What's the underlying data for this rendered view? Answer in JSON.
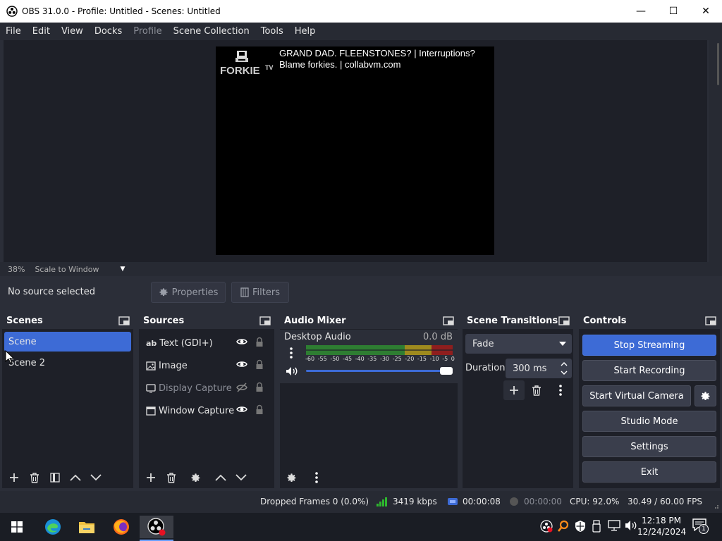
{
  "window": {
    "title": "OBS 31.0.0 - Profile: Untitled - Scenes: Untitled",
    "minimize": "—",
    "maximize": "☐",
    "close": "✕"
  },
  "menu": [
    "File",
    "Edit",
    "View",
    "Docks",
    "Profile",
    "Scene Collection",
    "Tools",
    "Help"
  ],
  "menu_disabled": [
    "Profile"
  ],
  "preview": {
    "logo_text": "FORKIE",
    "logo_sub": "TV",
    "overlay_line1": "GRAND DAD. FLEENSTONES? | Interruptions?",
    "overlay_line2": "Blame forkies. | collabvm.com"
  },
  "zoom": {
    "percent": "38%",
    "mode": "Scale to Window"
  },
  "context": {
    "no_source": "No source selected",
    "properties_label": "Properties",
    "filters_label": "Filters"
  },
  "scenes": {
    "title": "Scenes",
    "items": [
      {
        "label": "Scene",
        "selected": true
      },
      {
        "label": "Scene 2",
        "selected": false
      }
    ]
  },
  "sources": {
    "title": "Sources",
    "items": [
      {
        "label": "Text (GDI+)",
        "icon": "text-icon",
        "visible": true
      },
      {
        "label": "Image",
        "icon": "image-icon",
        "visible": true
      },
      {
        "label": "Display Capture",
        "icon": "monitor-icon",
        "visible": false
      },
      {
        "label": "Window Capture",
        "icon": "window-icon",
        "visible": true
      }
    ]
  },
  "mixer": {
    "title": "Audio Mixer",
    "track": {
      "name": "Desktop Audio",
      "db": "0.0 dB",
      "scale": [
        "-60",
        "-55",
        "-50",
        "-45",
        "-40",
        "-35",
        "-30",
        "-25",
        "-20",
        "-15",
        "-10",
        "-5",
        "0"
      ],
      "volume_fraction": 1.0
    }
  },
  "transitions": {
    "title": "Scene Transitions",
    "selected": "Fade",
    "duration_label": "Duration",
    "duration_value": "300 ms"
  },
  "controls": {
    "title": "Controls",
    "stop_streaming": "Stop Streaming",
    "start_recording": "Start Recording",
    "start_virtual_camera": "Start Virtual Camera",
    "studio_mode": "Studio Mode",
    "settings": "Settings",
    "exit": "Exit"
  },
  "status": {
    "dropped": "Dropped Frames 0 (0.0%)",
    "bitrate": "3419 kbps",
    "stream_time": "00:00:08",
    "rec_time": "00:00:00",
    "cpu": "CPU: 92.0%",
    "fps": "30.49 / 60.00 FPS"
  },
  "taskbar": {
    "time": "12:18 PM",
    "date": "12/24/2024",
    "notification_count": "1"
  },
  "colors": {
    "accent": "#3d6bd6",
    "panel": "#1e2028",
    "header": "#2b2e38",
    "meter_green": "#2e7d32",
    "meter_yellow": "#9e8a1e",
    "meter_red": "#8e1e1e"
  }
}
